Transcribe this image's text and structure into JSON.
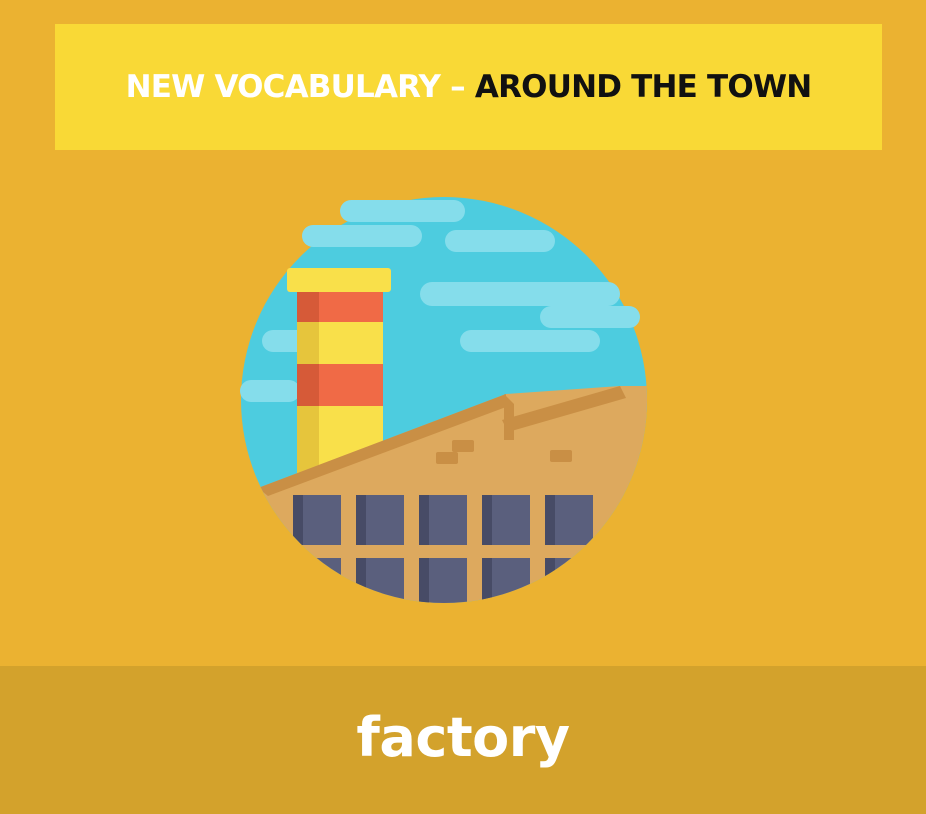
{
  "header": {
    "prefix": "NEW VOCABULARY",
    "separator": " – ",
    "suffix": "AROUND THE TOWN"
  },
  "card": {
    "word": "factory",
    "illustration_icon": "factory-icon"
  },
  "colors": {
    "background": "#EBB231",
    "banner": "#F9D936",
    "word_band": "#D3A22C",
    "sky": "#4DCCDF",
    "cloud": "#85DDEB",
    "chimney_red": "#F06A46",
    "chimney_yellow": "#F9E04A",
    "building": "#DDA95E",
    "roof": "#C98F45",
    "window": "#5A5F7D"
  }
}
